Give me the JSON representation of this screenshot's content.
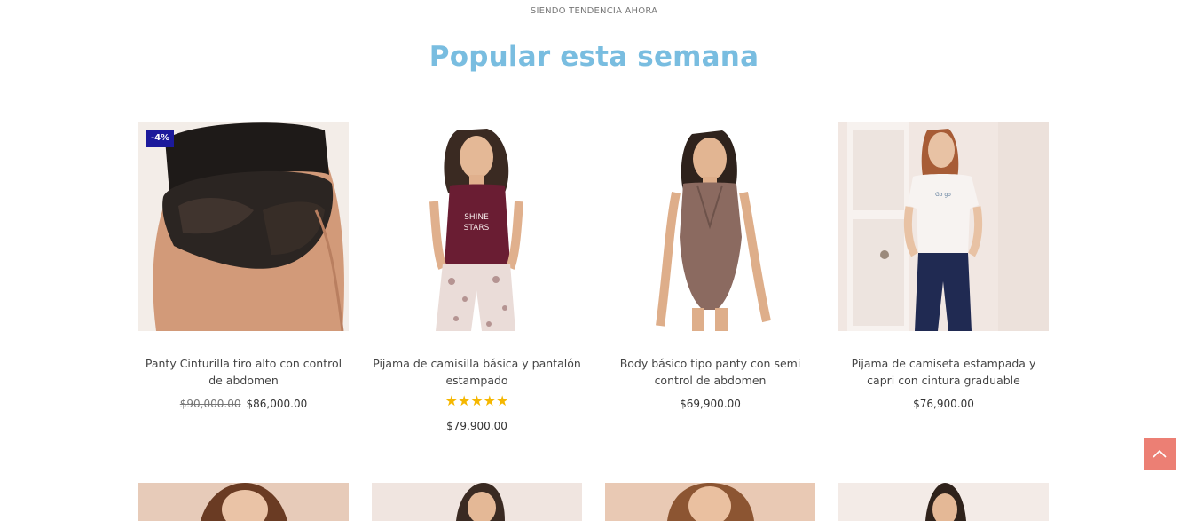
{
  "section": {
    "eyebrow": "SIENDO TENDENCIA AHORA",
    "title": "Popular esta semana"
  },
  "colors": {
    "title": "#79bde0",
    "badge": "#1c1a9c",
    "stars": "#f5b700",
    "scroll_top": "#ec7f74"
  },
  "products": [
    {
      "name": "Panty Cinturilla tiro alto con control de abdomen",
      "badge": "-4%",
      "old_price": "$90,000.00",
      "price": "$86,000.00"
    },
    {
      "name": "Pijama de camisilla básica y pantalón estampado",
      "rating": 5,
      "rating_stars": "★★★★★",
      "price": "$79,900.00"
    },
    {
      "name": "Body básico tipo panty con semi control de abdomen",
      "price": "$69,900.00"
    },
    {
      "name": "Pijama de camiseta estampada y capri con cintura graduable",
      "price": "$76,900.00"
    }
  ],
  "scroll_top_icon": "chevron-up-icon"
}
